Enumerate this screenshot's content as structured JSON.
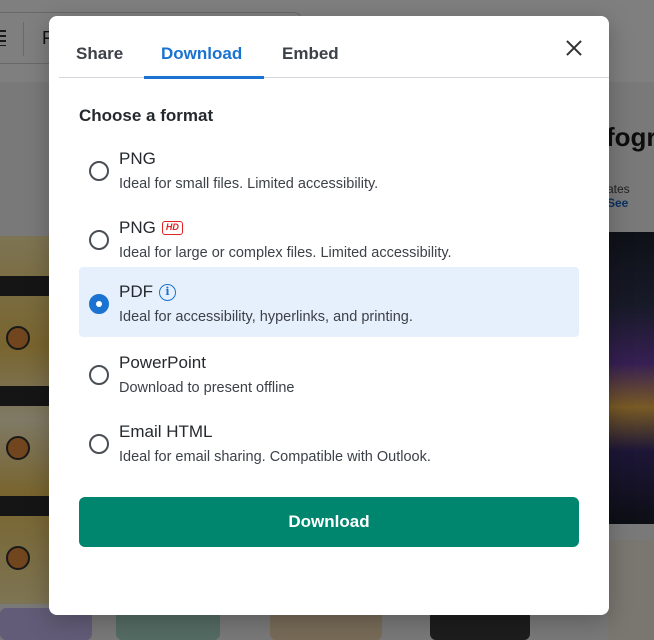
{
  "background": {
    "search_text": "F",
    "side_title": "fogr",
    "side_subtitle_prefix": "ates",
    "side_subtitle_link": "See"
  },
  "modal": {
    "tabs": [
      {
        "label": "Share",
        "active": false
      },
      {
        "label": "Download",
        "active": true
      },
      {
        "label": "Embed",
        "active": false
      }
    ],
    "heading": "Choose a format",
    "options": [
      {
        "title": "PNG",
        "badge": "",
        "description": "Ideal for small files. Limited accessibility.",
        "selected": false
      },
      {
        "title": "PNG",
        "badge": "HD",
        "description": "Ideal for large or complex files. Limited accessibility.",
        "selected": false
      },
      {
        "title": "PDF",
        "badge": "",
        "info_icon": "info-icon",
        "description": "Ideal for accessibility, hyperlinks, and printing.",
        "selected": true
      },
      {
        "title": "PowerPoint",
        "badge": "",
        "description": "Download to present offline",
        "selected": false
      },
      {
        "title": "Email HTML",
        "badge": "",
        "description": "Ideal for email sharing. Compatible with Outlook.",
        "selected": false
      }
    ],
    "primary_button": "Download",
    "close_icon": "close-icon"
  },
  "colors": {
    "accent": "#1a73d1",
    "primary_button": "#00856f",
    "selected_bg": "#e6f0fc",
    "hd_badge": "#e02424"
  }
}
